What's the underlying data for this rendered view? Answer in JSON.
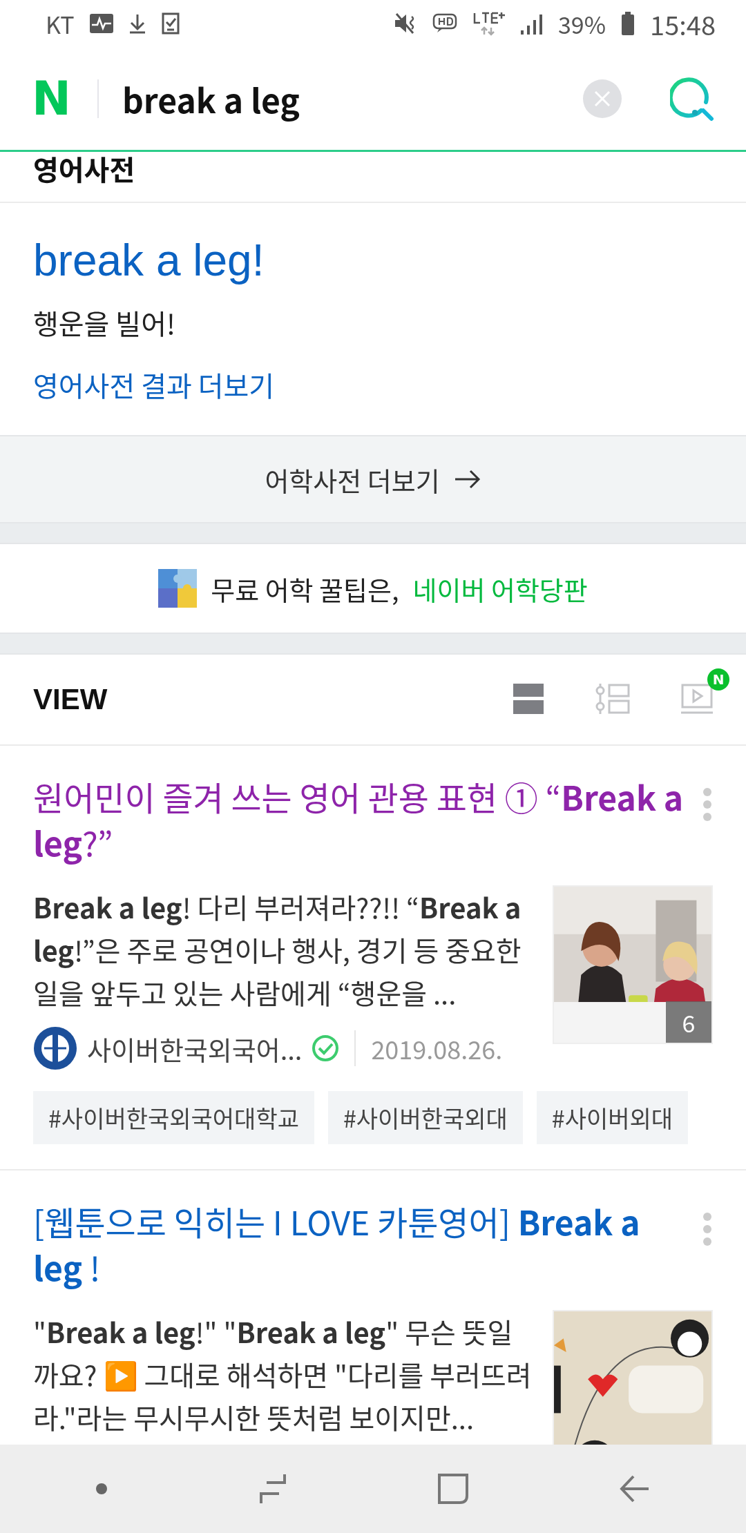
{
  "status_bar": {
    "carrier": "KT",
    "battery": "39%",
    "time": "15:48"
  },
  "search": {
    "logo": "N",
    "query": "break a leg"
  },
  "dictionary": {
    "section_title": "영어사전",
    "entry": "break a leg!",
    "meaning": "행운을 빌어!",
    "more_link": "영어사전 결과 더보기",
    "more_button": "어학사전 더보기"
  },
  "promo": {
    "text": "무료 어학 꿀팁은,",
    "link": "네이버 어학당판"
  },
  "view": {
    "title": "VIEW",
    "modes": [
      {
        "kind": "card",
        "selected": true
      },
      {
        "kind": "list",
        "selected": false
      },
      {
        "kind": "video",
        "selected": false,
        "badge": "N"
      }
    ]
  },
  "articles": [
    {
      "title": "원어민이 즐겨 쓰는 영어 관용 표현 ① “**Break a leg**?”",
      "visited": true,
      "snippet": "**Break a leg**! 다리 부러져라??!! “**Break a leg**!”은 주로 공연이나 행사, 경기 등 중요한 일을 앞두고 있는 사람에게 “행운을 ...",
      "source": "사이버한국외국어...",
      "verified": true,
      "date": "2019.08.26.",
      "image_count": "6",
      "tags": [
        "#사이버한국외국어대학교",
        "#사이버한국외대",
        "#사이버외대"
      ]
    },
    {
      "title": "[웹툰으로 익히는 I LOVE 카툰영어] **Break a leg** !",
      "visited": false,
      "snippet": "\"**Break a leg**!\" \"**Break a leg**\" 무슨 뜻일까요? ▶️ 그대로 해석하면 \"다리를 부러뜨려라.\"라는 무시무시한 뜻처럼 보이지만..."
    }
  ]
}
